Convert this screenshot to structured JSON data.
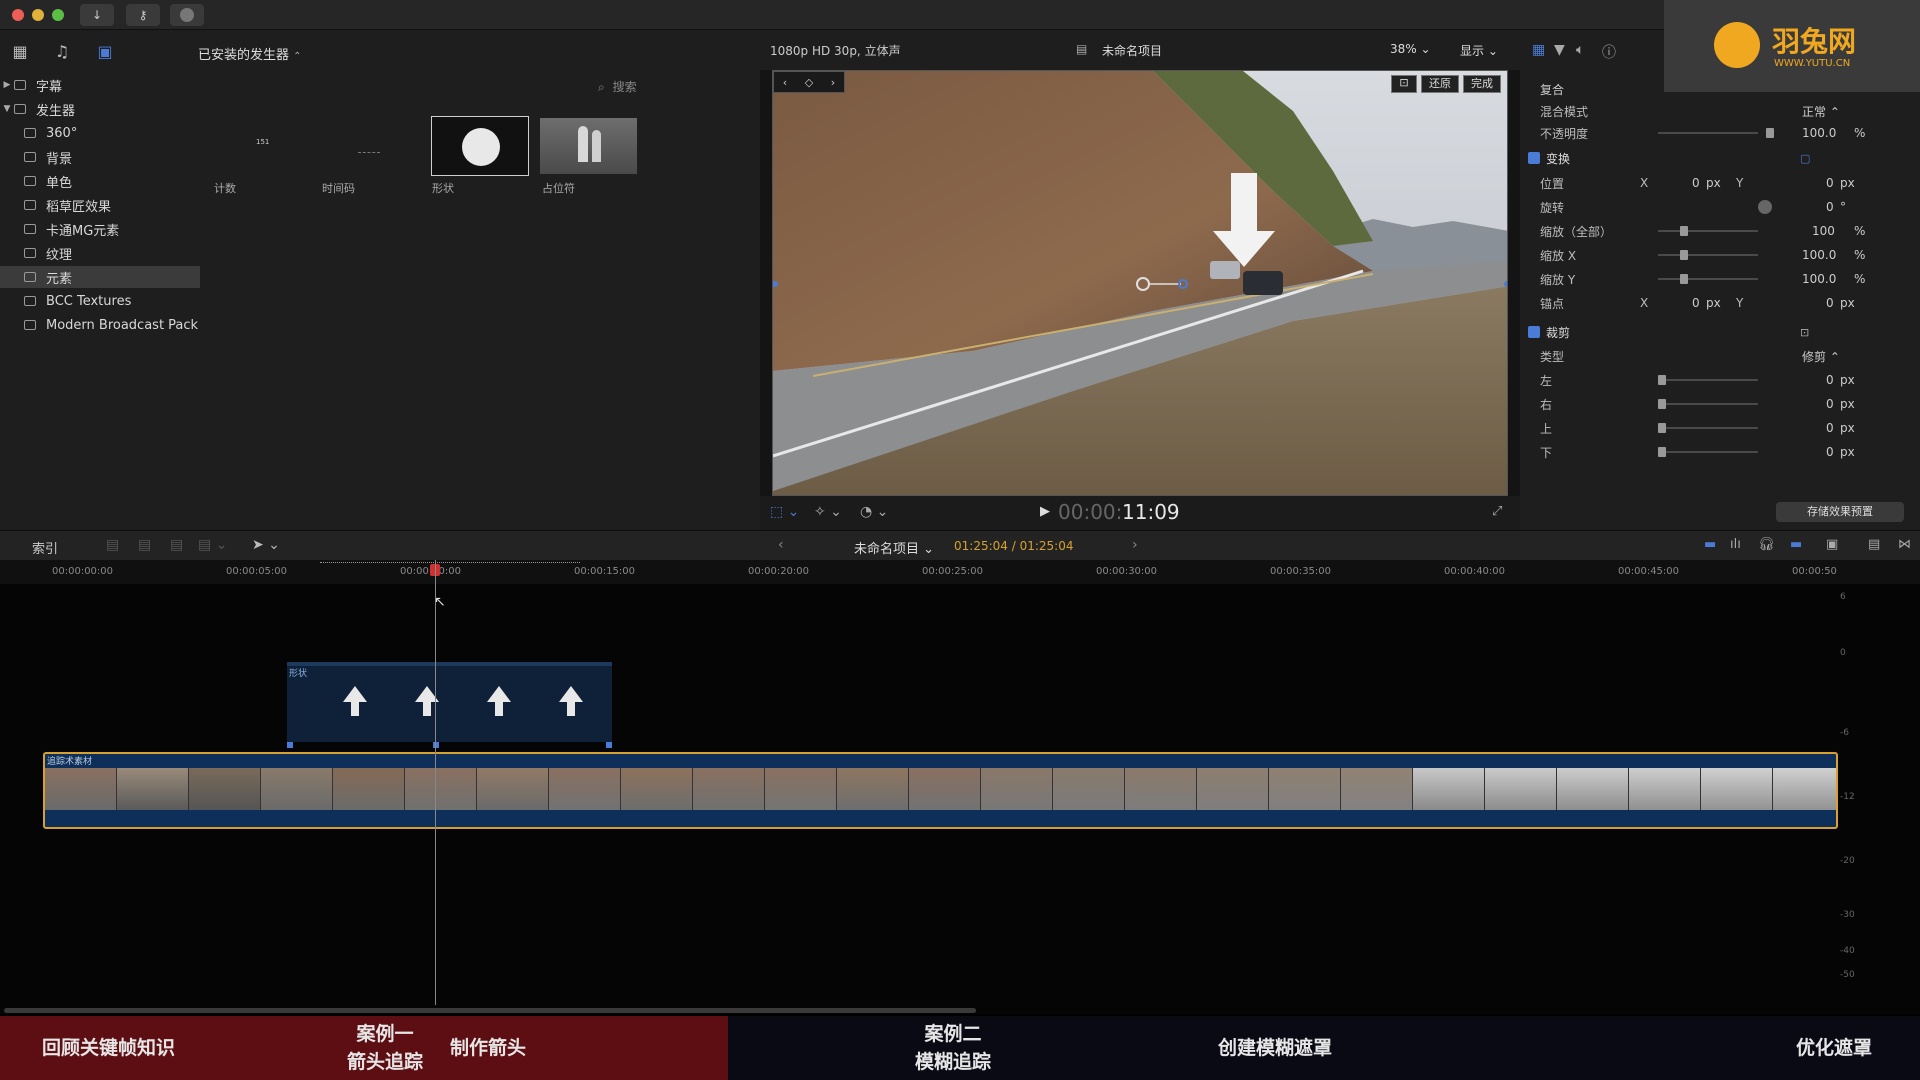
{
  "colors": {
    "accent": "#4a7bd6",
    "clip_border": "#d6a12e",
    "playhead": "#d03030",
    "timecode": "#d6a12e",
    "band_red": "#5c0e12"
  },
  "toolbar": {
    "download_icon": "download-icon",
    "key_icon": "key-icon",
    "status_icon": "status-icon"
  },
  "browser": {
    "dropdown": "已安装的发生器",
    "search_placeholder": "搜索",
    "sidebar": [
      {
        "label": "字幕",
        "type": "group",
        "expanded": false
      },
      {
        "label": "发生器",
        "type": "group",
        "expanded": true
      },
      {
        "label": "360°",
        "type": "child"
      },
      {
        "label": "背景",
        "type": "child"
      },
      {
        "label": "单色",
        "type": "child"
      },
      {
        "label": "稻草匠效果",
        "type": "child"
      },
      {
        "label": "卡通MG元素",
        "type": "child"
      },
      {
        "label": "纹理",
        "type": "child"
      },
      {
        "label": "元素",
        "type": "child",
        "selected": true
      },
      {
        "label": "BCC Textures",
        "type": "child"
      },
      {
        "label": "Modern Broadcast Pack",
        "type": "child"
      }
    ],
    "generators": [
      {
        "label": "计数",
        "thumb_text": "151"
      },
      {
        "label": "时间码",
        "thumb_text": ""
      },
      {
        "label": "形状",
        "thumb_text": ""
      },
      {
        "label": "占位符",
        "thumb_text": ""
      }
    ]
  },
  "viewer": {
    "format": "1080p HD 30p, 立体声",
    "project_name": "未命名项目",
    "zoom": "38%",
    "display_menu": "显示",
    "buttons": {
      "reset": "还原",
      "done": "完成"
    },
    "timecode_prefix": "00:00:",
    "timecode": "11:09"
  },
  "inspector": {
    "section_composite": "复合",
    "blend_mode_label": "混合模式",
    "blend_mode_value": "正常",
    "opacity_label": "不透明度",
    "opacity_value": "100.0",
    "opacity_unit": "%",
    "transform_label": "变换",
    "position_label": "位置",
    "pos_x_label": "X",
    "pos_x": "0",
    "pos_x_unit": "px",
    "pos_y_label": "Y",
    "pos_y": "0",
    "pos_y_unit": "px",
    "rotation_label": "旋转",
    "rotation": "0",
    "rotation_unit": "°",
    "scale_all_label": "缩放（全部）",
    "scale_all": "100",
    "scale_all_unit": "%",
    "scale_x_label": "缩放 X",
    "scale_x": "100.0",
    "scale_x_unit": "%",
    "scale_y_label": "缩放 Y",
    "scale_y": "100.0",
    "scale_y_unit": "%",
    "anchor_label": "锚点",
    "anc_x_label": "X",
    "anc_x": "0",
    "anc_x_unit": "px",
    "anc_y_label": "Y",
    "anc_y": "0",
    "anc_y_unit": "px",
    "crop_label": "裁剪",
    "crop_type_label": "类型",
    "crop_type_value": "修剪",
    "left_label": "左",
    "left": "0",
    "left_unit": "px",
    "right_label": "右",
    "right": "0",
    "right_unit": "px",
    "top_label": "上",
    "top": "0",
    "top_unit": "px",
    "bottom_label": "下",
    "bottom": "0",
    "bottom_unit": "px",
    "save_preset": "存储效果预置"
  },
  "logo": {
    "name": "羽兔网",
    "url": "WWW.YUTU.CN"
  },
  "timeline": {
    "index_label": "索引",
    "project_menu": "未命名项目",
    "duration": "01:25:04 / 01:25:04",
    "ruler": [
      "00:00:00:00",
      "00:00:05:00",
      "00:00:10:00",
      "00:00:15:00",
      "00:00:20:00",
      "00:00:25:00",
      "00:00:30:00",
      "00:00:35:00",
      "00:00:40:00",
      "00:00:45:00",
      "00:00:50"
    ],
    "shape_clip_label": "形状",
    "main_clip_label": "追踪术素材",
    "meter_labels": [
      "6",
      "0",
      "-6",
      "-12",
      "-20",
      "-30",
      "-40",
      "-50"
    ]
  },
  "chapters": {
    "review": "回顾关键帧知识",
    "case1_title": "案例一",
    "case1_sub": "箭头追踪",
    "make_arrow": "制作箭头",
    "case2_title": "案例二",
    "case2_sub": "模糊追踪",
    "create_mask": "创建模糊遮罩",
    "optimize_mask": "优化遮罩"
  }
}
